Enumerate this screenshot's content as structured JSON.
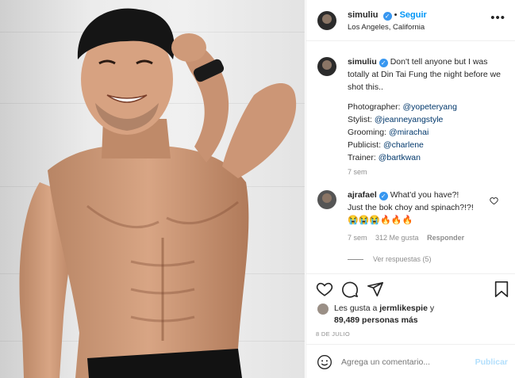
{
  "post": {
    "username": "simuliu",
    "follow_label": "Seguir",
    "location": "Los Angeles, California",
    "more_icon": "more-options-icon"
  },
  "caption": {
    "username": "simuliu",
    "text": "Don't tell anyone but I was totally at Din Tai Fung the night before we shot this..",
    "credits": [
      {
        "role": "Photographer:",
        "handle": "@yopeteryang"
      },
      {
        "role": "Stylist:",
        "handle": "@jeanneyangstyle"
      },
      {
        "role": "Grooming:",
        "handle": "@mirachai"
      },
      {
        "role": "Publicist:",
        "handle": "@charlene"
      },
      {
        "role": "Trainer:",
        "handle": "@bartkwan"
      }
    ],
    "time": "7 sem"
  },
  "comment": {
    "username": "ajrafael",
    "line1": "What'd you have?!",
    "line2": "Just the bok choy and spinach?!?!",
    "emojis": "😭😭😭🔥🔥🔥",
    "time": "7 sem",
    "likes": "312 Me gusta",
    "reply_label": "Responder",
    "view_replies": "Ver respuestas (5)"
  },
  "likes": {
    "prefix": "Les gusta a",
    "user": "jermlikespie",
    "connector": "y",
    "others": "89,489 personas más"
  },
  "date": "8 DE JULIO",
  "add_comment": {
    "placeholder": "Agrega un comentario...",
    "publish_label": "Publicar"
  },
  "colors": {
    "accent": "#0095f6",
    "verified": "#3897f0",
    "text": "#262626",
    "muted": "#8e8e8e"
  }
}
